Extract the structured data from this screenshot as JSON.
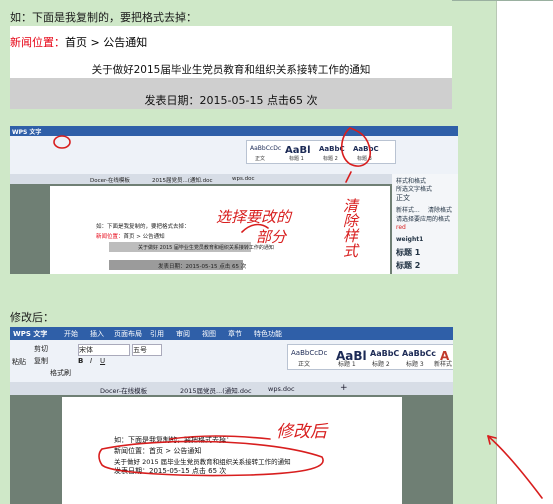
{
  "intro_text": "如：下面是我复制的，要把格式去掉：",
  "news": {
    "breadcrumb_red": "新闻位置：",
    "breadcrumb_rest": "首页 > 公告通知",
    "title": "关于做好2015届毕业生党员教育和组织关系接转工作的通知",
    "date": "发表日期：2015-05-15 点击65 次"
  },
  "after_label": "修改后：",
  "screenshot1": {
    "app_name": "WPS 文字",
    "tab_docer": "Docer-在线模板",
    "tab_file": "2015届党员...(通知.doc",
    "tab_wps": "wps.doc",
    "doc_line1": "如：下面是我复制的，要把格式去掉：",
    "doc_line2_red": "新闻位置：",
    "doc_line2_rest": "首页 > 公告通知",
    "doc_title": "关于做好 2015 届毕业生党员教育和组织关系接转工作的通知",
    "doc_date": "发表日期：2015-05-15 点击 65 次",
    "styles": [
      "AaBbCcDc",
      "AaBl",
      "AaBbC",
      "AaBbC"
    ],
    "style_names": [
      "正文",
      "标题 1",
      "标题 2",
      "标题 3"
    ],
    "side_items": [
      "样式和格式",
      "所选文字格式",
      "正文",
      "新样式...",
      "清除格式",
      "请选择要应用的格式",
      "red",
      "weight1",
      "标题 1",
      "标题 2"
    ],
    "annotation_select": "选择要改的部分",
    "annotation_clear": "清除样式"
  },
  "screenshot2": {
    "app_name": "WPS 文字",
    "menus": [
      "开始",
      "插入",
      "页面布局",
      "引用",
      "审阅",
      "视图",
      "章节",
      "特色功能"
    ],
    "font_name": "宋体",
    "font_size": "五号",
    "paste_label": "粘贴",
    "cut_label": "剪切",
    "copy_label": "复制",
    "format_painter_label": "格式刷",
    "styles": [
      "AaBbCcDc",
      "AaBl",
      "AaBbC",
      "AaBbCc",
      "A"
    ],
    "style_names": [
      "正文",
      "标题 1",
      "标题 2",
      "标题 3",
      "新样式"
    ],
    "tab_docer": "Docer-在线模板",
    "tab_file": "2015届党员...(通知.doc",
    "tab_wps": "wps.doc",
    "doc_line1": "如：下面是我复制的，要把格式去掉：",
    "doc_line2": "新闻位置：首页 > 公告通知",
    "doc_line3": "关于做好 2015 届毕业生党员教育和组织关系接转工作的通知",
    "doc_line4": "发表日期：2015-05-15 点击 65 次",
    "annotation": "修改后"
  },
  "colors": {
    "panel_bg": "#cfe8c8",
    "red": "#e60012",
    "titlebar": "#2f5fa8",
    "annotation": "#d81e1e"
  }
}
